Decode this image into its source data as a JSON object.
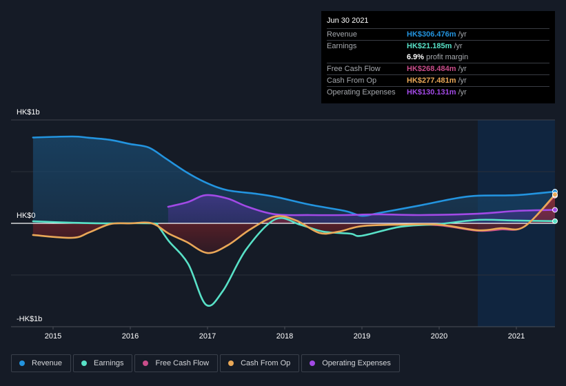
{
  "chart_data": {
    "type": "area",
    "title": "",
    "xlabel": "",
    "ylabel": "",
    "currency_unit": "HK$m",
    "ylim": [
      -1000,
      1000
    ],
    "xlim": [
      2014.74,
      2021.5
    ],
    "y_tick_labels": [
      {
        "value": 1000,
        "label": "HK$1b"
      },
      {
        "value": 0,
        "label": "HK$0"
      },
      {
        "value": -1000,
        "label": "-HK$1b"
      }
    ],
    "x_ticks": [
      2015,
      2016,
      2017,
      2018,
      2019,
      2020,
      2021
    ],
    "x_tick_labels": [
      "2015",
      "2016",
      "2017",
      "2018",
      "2019",
      "2020",
      "2021"
    ],
    "grid": true,
    "highlight_range": [
      2020.5,
      2021.5
    ],
    "series": [
      {
        "name": "Revenue",
        "color": "#2394df",
        "fill": true,
        "points": [
          [
            2014.74,
            830
          ],
          [
            2015.25,
            840
          ],
          [
            2015.47,
            827
          ],
          [
            2015.74,
            807
          ],
          [
            2016.0,
            767
          ],
          [
            2016.24,
            733
          ],
          [
            2016.46,
            627
          ],
          [
            2016.73,
            493
          ],
          [
            2017.0,
            387
          ],
          [
            2017.26,
            320
          ],
          [
            2017.62,
            287
          ],
          [
            2017.9,
            253
          ],
          [
            2018.33,
            180
          ],
          [
            2018.78,
            120
          ],
          [
            2019.0,
            73
          ],
          [
            2019.22,
            100
          ],
          [
            2019.75,
            173
          ],
          [
            2020.2,
            240
          ],
          [
            2020.5,
            267
          ],
          [
            2021.0,
            273
          ],
          [
            2021.5,
            306.476
          ]
        ]
      },
      {
        "name": "Earnings",
        "color": "#58e1c7",
        "fill": false,
        "points": [
          [
            2014.74,
            20
          ],
          [
            2015.2,
            7
          ],
          [
            2015.65,
            0
          ],
          [
            2016.28,
            0
          ],
          [
            2016.36,
            -27
          ],
          [
            2016.5,
            -173
          ],
          [
            2016.75,
            -393
          ],
          [
            2016.98,
            -787
          ],
          [
            2017.2,
            -653
          ],
          [
            2017.5,
            -253
          ],
          [
            2017.88,
            40
          ],
          [
            2018.2,
            -13
          ],
          [
            2018.5,
            -80
          ],
          [
            2018.85,
            -100
          ],
          [
            2019.0,
            -120
          ],
          [
            2019.5,
            -33
          ],
          [
            2020.0,
            -7
          ],
          [
            2020.5,
            33
          ],
          [
            2021.0,
            27
          ],
          [
            2021.5,
            21.185
          ]
        ]
      },
      {
        "name": "Free Cash Flow",
        "color": "#c94d8a",
        "fill": true,
        "points": [
          [
            2014.74,
            -113
          ],
          [
            2015.25,
            -140
          ],
          [
            2015.47,
            -87
          ],
          [
            2015.74,
            -7
          ],
          [
            2016.0,
            0
          ],
          [
            2016.28,
            0
          ],
          [
            2016.5,
            -100
          ],
          [
            2016.73,
            -180
          ],
          [
            2017.0,
            -287
          ],
          [
            2017.26,
            -213
          ],
          [
            2017.55,
            -60
          ],
          [
            2017.88,
            67
          ],
          [
            2018.15,
            27
          ],
          [
            2018.45,
            -93
          ],
          [
            2018.7,
            -80
          ],
          [
            2019.0,
            -27
          ],
          [
            2019.5,
            -13
          ],
          [
            2020.0,
            -20
          ],
          [
            2020.5,
            -73
          ],
          [
            2020.8,
            -60
          ],
          [
            2021.1,
            -33
          ],
          [
            2021.5,
            268.484
          ]
        ]
      },
      {
        "name": "Cash From Op",
        "color": "#e9a857",
        "fill": false,
        "points": [
          [
            2014.74,
            -113
          ],
          [
            2015.25,
            -140
          ],
          [
            2015.47,
            -87
          ],
          [
            2015.74,
            -7
          ],
          [
            2016.0,
            0
          ],
          [
            2016.28,
            0
          ],
          [
            2016.5,
            -100
          ],
          [
            2016.73,
            -180
          ],
          [
            2017.0,
            -287
          ],
          [
            2017.26,
            -213
          ],
          [
            2017.55,
            -60
          ],
          [
            2017.88,
            67
          ],
          [
            2018.15,
            27
          ],
          [
            2018.45,
            -93
          ],
          [
            2018.7,
            -80
          ],
          [
            2019.0,
            -27
          ],
          [
            2019.5,
            -13
          ],
          [
            2020.0,
            -13
          ],
          [
            2020.5,
            -67
          ],
          [
            2020.8,
            -47
          ],
          [
            2021.1,
            -33
          ],
          [
            2021.5,
            277.481
          ]
        ]
      },
      {
        "name": "Operating Expenses",
        "color": "#a24ae6",
        "fill": true,
        "points": [
          [
            2016.49,
            160
          ],
          [
            2016.75,
            207
          ],
          [
            2016.98,
            273
          ],
          [
            2017.26,
            240
          ],
          [
            2017.52,
            160
          ],
          [
            2017.88,
            87
          ],
          [
            2018.33,
            80
          ],
          [
            2018.78,
            80
          ],
          [
            2019.22,
            87
          ],
          [
            2019.75,
            80
          ],
          [
            2020.5,
            93
          ],
          [
            2021.0,
            120
          ],
          [
            2021.5,
            130.131
          ]
        ]
      }
    ]
  },
  "tooltip": {
    "date": "Jun 30 2021",
    "rows": [
      {
        "label": "Revenue",
        "value": "HK$306.476m",
        "unit": "/yr",
        "color": "#2394df"
      },
      {
        "label": "Earnings",
        "value": "HK$21.185m",
        "unit": "/yr",
        "color": "#58e1c7"
      },
      {
        "label": "",
        "value": "6.9%",
        "unit": "profit margin",
        "color": "#ffffff"
      },
      {
        "label": "Free Cash Flow",
        "value": "HK$268.484m",
        "unit": "/yr",
        "color": "#c94d8a"
      },
      {
        "label": "Cash From Op",
        "value": "HK$277.481m",
        "unit": "/yr",
        "color": "#e9a857"
      },
      {
        "label": "Operating Expenses",
        "value": "HK$130.131m",
        "unit": "/yr",
        "color": "#a24ae6"
      }
    ]
  },
  "legend": [
    {
      "label": "Revenue",
      "color": "#2394df"
    },
    {
      "label": "Earnings",
      "color": "#58e1c7"
    },
    {
      "label": "Free Cash Flow",
      "color": "#c94d8a"
    },
    {
      "label": "Cash From Op",
      "color": "#e9a857"
    },
    {
      "label": "Operating Expenses",
      "color": "#a24ae6"
    }
  ]
}
